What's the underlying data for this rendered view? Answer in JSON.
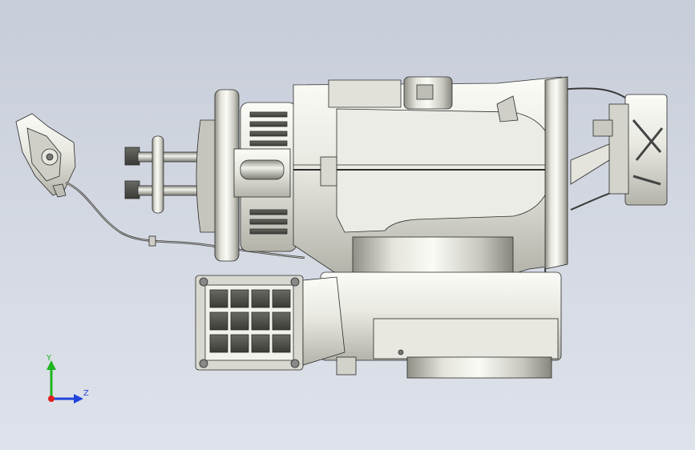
{
  "view": {
    "background_top": "#c7cdd9",
    "background_bottom": "#dee2ea"
  },
  "triad": {
    "y_label": "Y",
    "z_label": "Z",
    "y_color": "#1fb41f",
    "z_color": "#2244dd",
    "x_color": "#e02020"
  },
  "model": {
    "description_icon": "cad-assembly-model",
    "line_color": "#2a2a2a",
    "body_light": "#f3f3ee",
    "body_mid": "#d9d9d2",
    "body_dark": "#9a9a92"
  }
}
